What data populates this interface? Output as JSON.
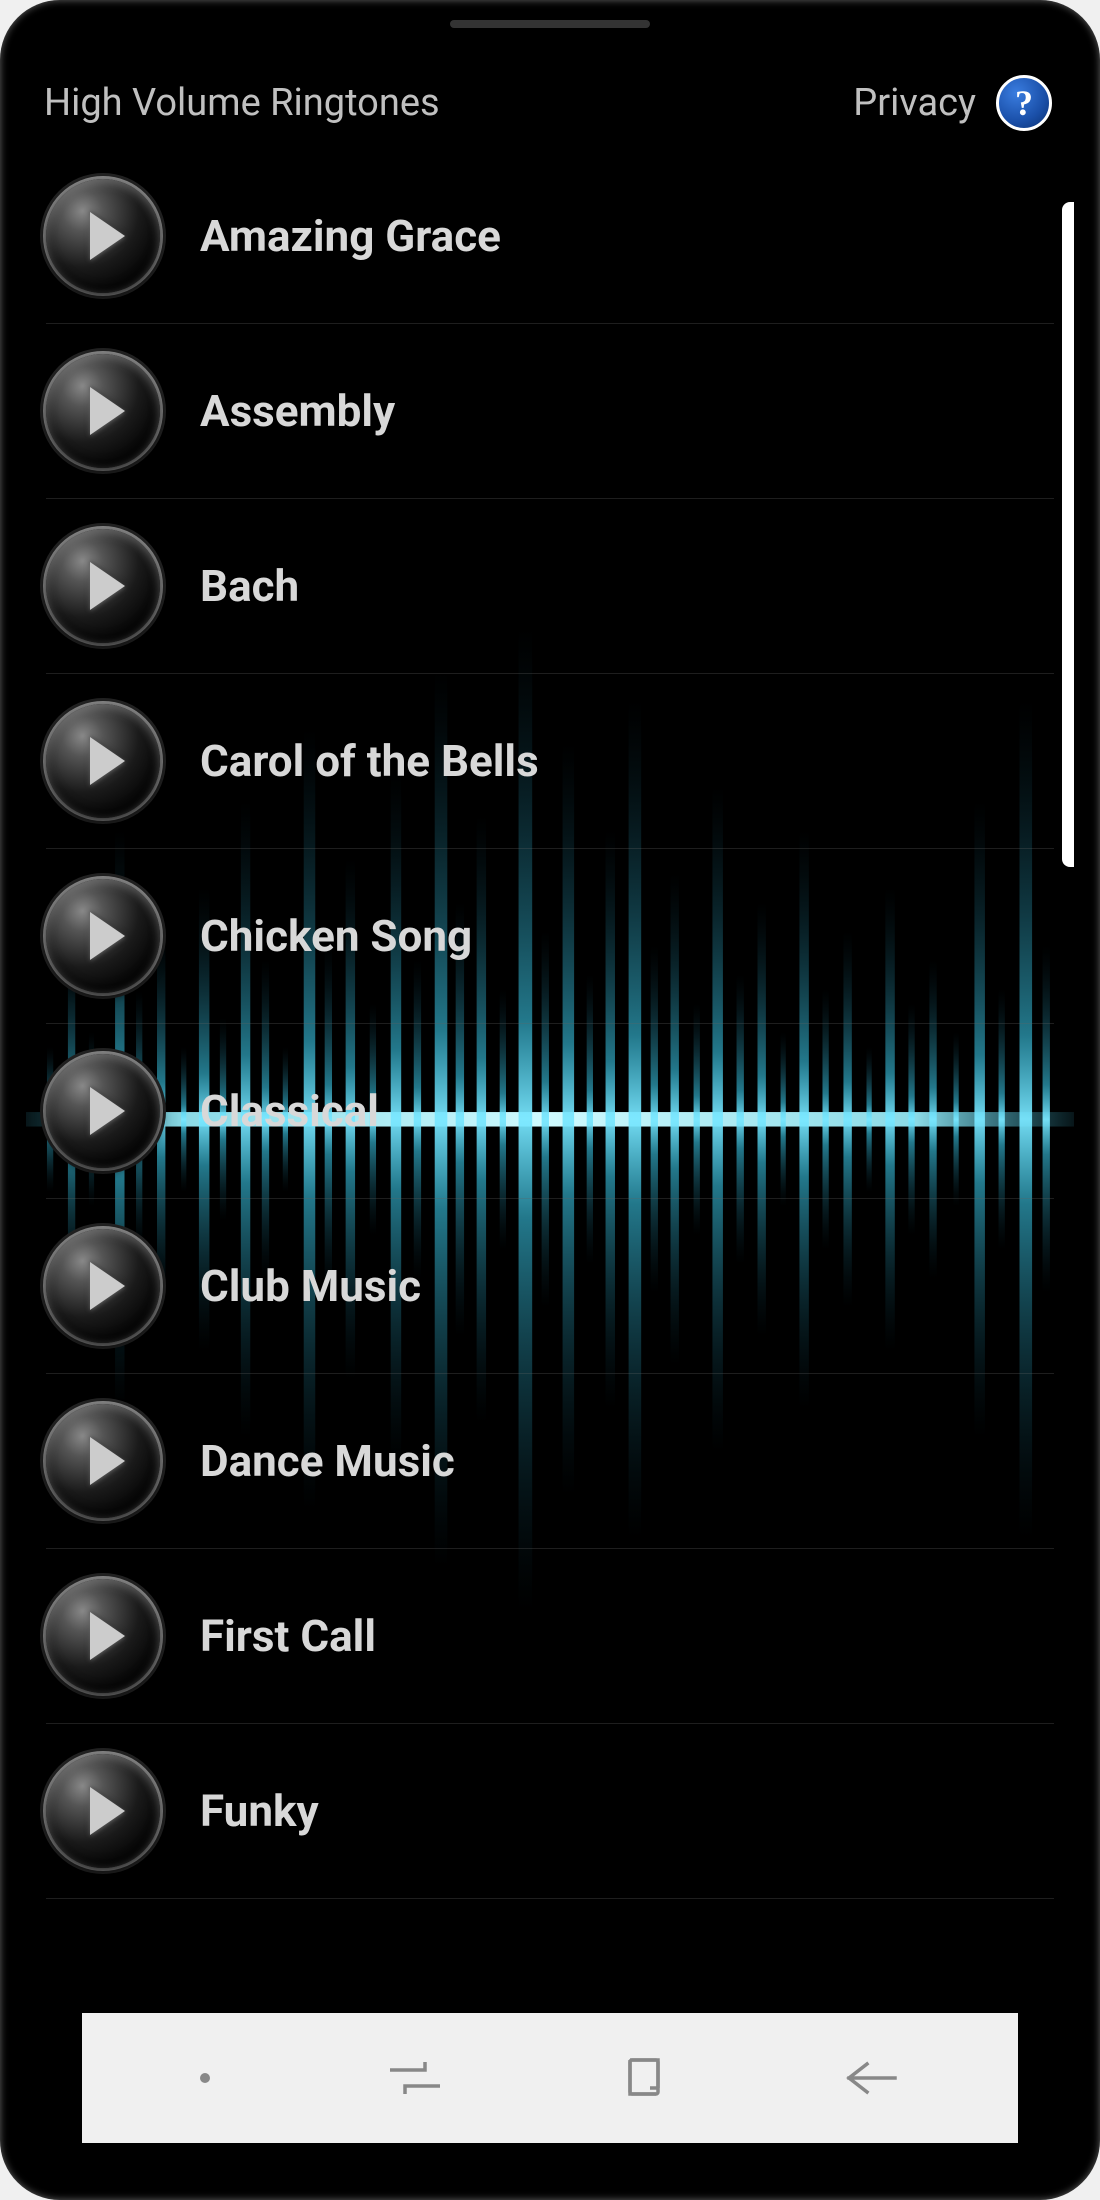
{
  "header": {
    "title": "High Volume Ringtones",
    "privacy_label": "Privacy",
    "help_symbol": "?"
  },
  "ringtones": [
    {
      "label": "Amazing Grace"
    },
    {
      "label": "Assembly"
    },
    {
      "label": "Bach"
    },
    {
      "label": "Carol of the Bells"
    },
    {
      "label": "Chicken Song"
    },
    {
      "label": "Classical"
    },
    {
      "label": "Club Music"
    },
    {
      "label": "Dance Music"
    },
    {
      "label": "First Call"
    },
    {
      "label": "Funky"
    }
  ]
}
